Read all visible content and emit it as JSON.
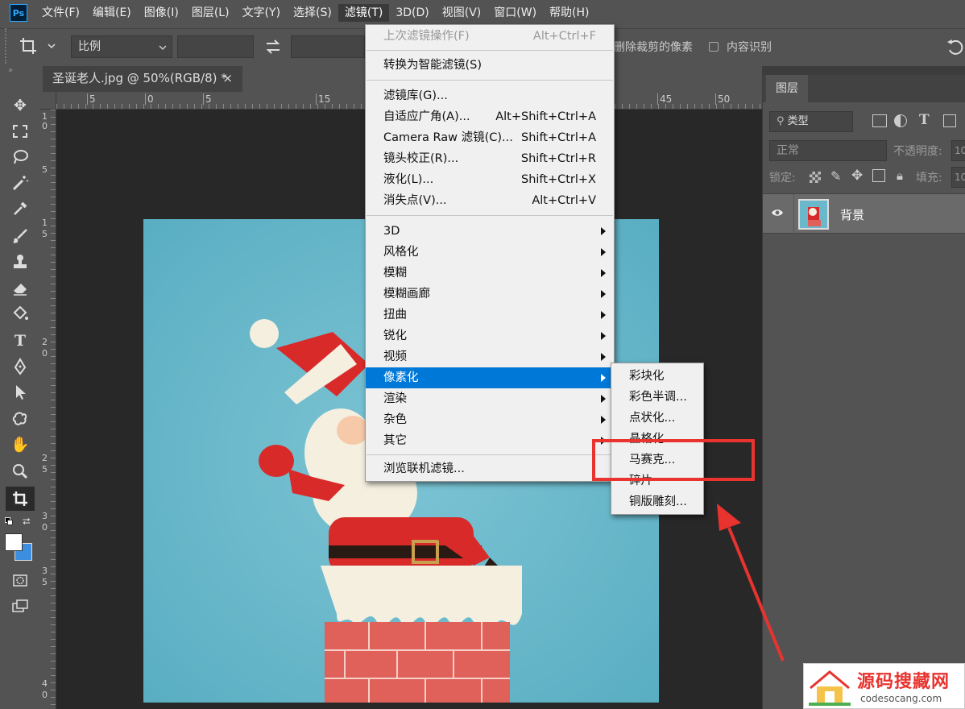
{
  "menubar": {
    "logo": "Ps",
    "items": [
      "文件(F)",
      "编辑(E)",
      "图像(I)",
      "图层(L)",
      "文字(Y)",
      "选择(S)",
      "滤镜(T)",
      "3D(D)",
      "视图(V)",
      "窗口(W)",
      "帮助(H)"
    ]
  },
  "options": {
    "ratio": "比例",
    "delete_crop": "删除裁剪的像素",
    "content_aware": "内容识别"
  },
  "document_tab": {
    "title": "圣诞老人.jpg @ 50%(RGB/8) *",
    "close": "×"
  },
  "ruler": {
    "h_ticks": [
      "5",
      "0",
      "5",
      "15",
      "45",
      "50"
    ],
    "v_ticks": [
      "1",
      "0",
      "5",
      "1",
      "5",
      "2",
      "0",
      "2",
      "5",
      "3",
      "0",
      "3",
      "5",
      "4",
      "0"
    ]
  },
  "layers_panel": {
    "tab": "图层",
    "filter_kind": "类型",
    "blend_mode": "正常",
    "opacity_label": "不透明度:",
    "opacity_value": "10",
    "lock_label": "锁定:",
    "fill_label": "填充:",
    "fill_value": "10",
    "layer_name": "背景"
  },
  "filter_menu": {
    "items": [
      {
        "label": "上次滤镜操作(F)",
        "shortcut": "Alt+Ctrl+F",
        "disabled": true
      },
      {
        "label": "转换为智能滤镜(S)",
        "shortcut": ""
      },
      {
        "label": "滤镜库(G)...",
        "shortcut": ""
      },
      {
        "label": "自适应广角(A)...",
        "shortcut": "Alt+Shift+Ctrl+A"
      },
      {
        "label": "Camera Raw 滤镜(C)...",
        "shortcut": "Shift+Ctrl+A"
      },
      {
        "label": "镜头校正(R)...",
        "shortcut": "Shift+Ctrl+R"
      },
      {
        "label": "液化(L)...",
        "shortcut": "Shift+Ctrl+X"
      },
      {
        "label": "消失点(V)...",
        "shortcut": "Alt+Ctrl+V"
      },
      {
        "label": "3D",
        "submenu": true
      },
      {
        "label": "风格化",
        "submenu": true
      },
      {
        "label": "模糊",
        "submenu": true
      },
      {
        "label": "模糊画廊",
        "submenu": true
      },
      {
        "label": "扭曲",
        "submenu": true
      },
      {
        "label": "锐化",
        "submenu": true
      },
      {
        "label": "视频",
        "submenu": true
      },
      {
        "label": "像素化",
        "submenu": true,
        "highlighted": true
      },
      {
        "label": "渲染",
        "submenu": true
      },
      {
        "label": "杂色",
        "submenu": true
      },
      {
        "label": "其它",
        "submenu": true
      },
      {
        "label": "浏览联机滤镜...",
        "shortcut": ""
      }
    ]
  },
  "pixelate_submenu": {
    "items": [
      "彩块化",
      "彩色半调...",
      "点状化...",
      "晶格化...",
      "马赛克...",
      "碎片",
      "铜版雕刻..."
    ]
  },
  "watermark": {
    "title": "源码搜藏网",
    "url": "codesocang.com"
  },
  "colors": {
    "accent": "#0078d7",
    "annotation": "#e8332f",
    "canvas_bg": "#6ab8ca"
  }
}
